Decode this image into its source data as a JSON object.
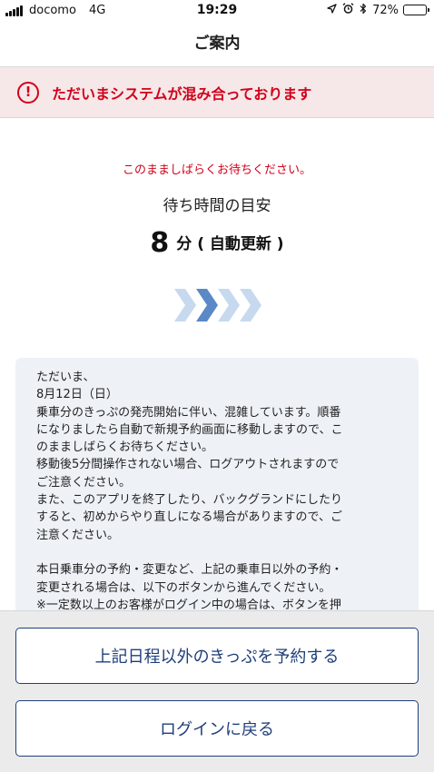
{
  "status_bar": {
    "carrier": "docomo",
    "network": "4G",
    "time": "19:29",
    "battery": "72%",
    "battery_level": 0.72
  },
  "nav": {
    "title": "ご案内"
  },
  "alert": {
    "text": "ただいまシステムが混み合っております",
    "color": "#d0021b"
  },
  "main": {
    "wait_message": "このまましばらくお待ちください。",
    "wait_label": "待ち時間の目安",
    "wait_minutes": "8",
    "wait_unit": "分 ( 自動更新 )"
  },
  "info": {
    "lines": [
      "ただいま、",
      "8月12日（日）",
      "乗車分のきっぷの発売開始に伴い、混雑しています。順番",
      "になりましたら自動で新規予約画面に移動しますので、こ",
      "のまましばらくお待ちください。",
      "移動後5分間操作されない場合、ログアウトされますので",
      "ご注意ください。",
      "また、このアプリを終了したり、バックグランドにしたり",
      "すると、初めからやり直しになる場合がありますので、ご",
      "注意ください。",
      "",
      "本日乗車分の予約・変更など、上記の乗車日以外の予約・",
      "変更される場合は、以下のボタンから進んでください。",
      "※一定数以上のお客様がログイン中の場合は、ボタンを押"
    ]
  },
  "buttons": {
    "reserve_other": "上記日程以外のきっぷを予約する",
    "back_to_login": "ログインに戻る"
  },
  "colors": {
    "accent": "#1f3f7a",
    "alert_bg": "#f6e7e8",
    "panel_bg": "#eef2f7"
  }
}
